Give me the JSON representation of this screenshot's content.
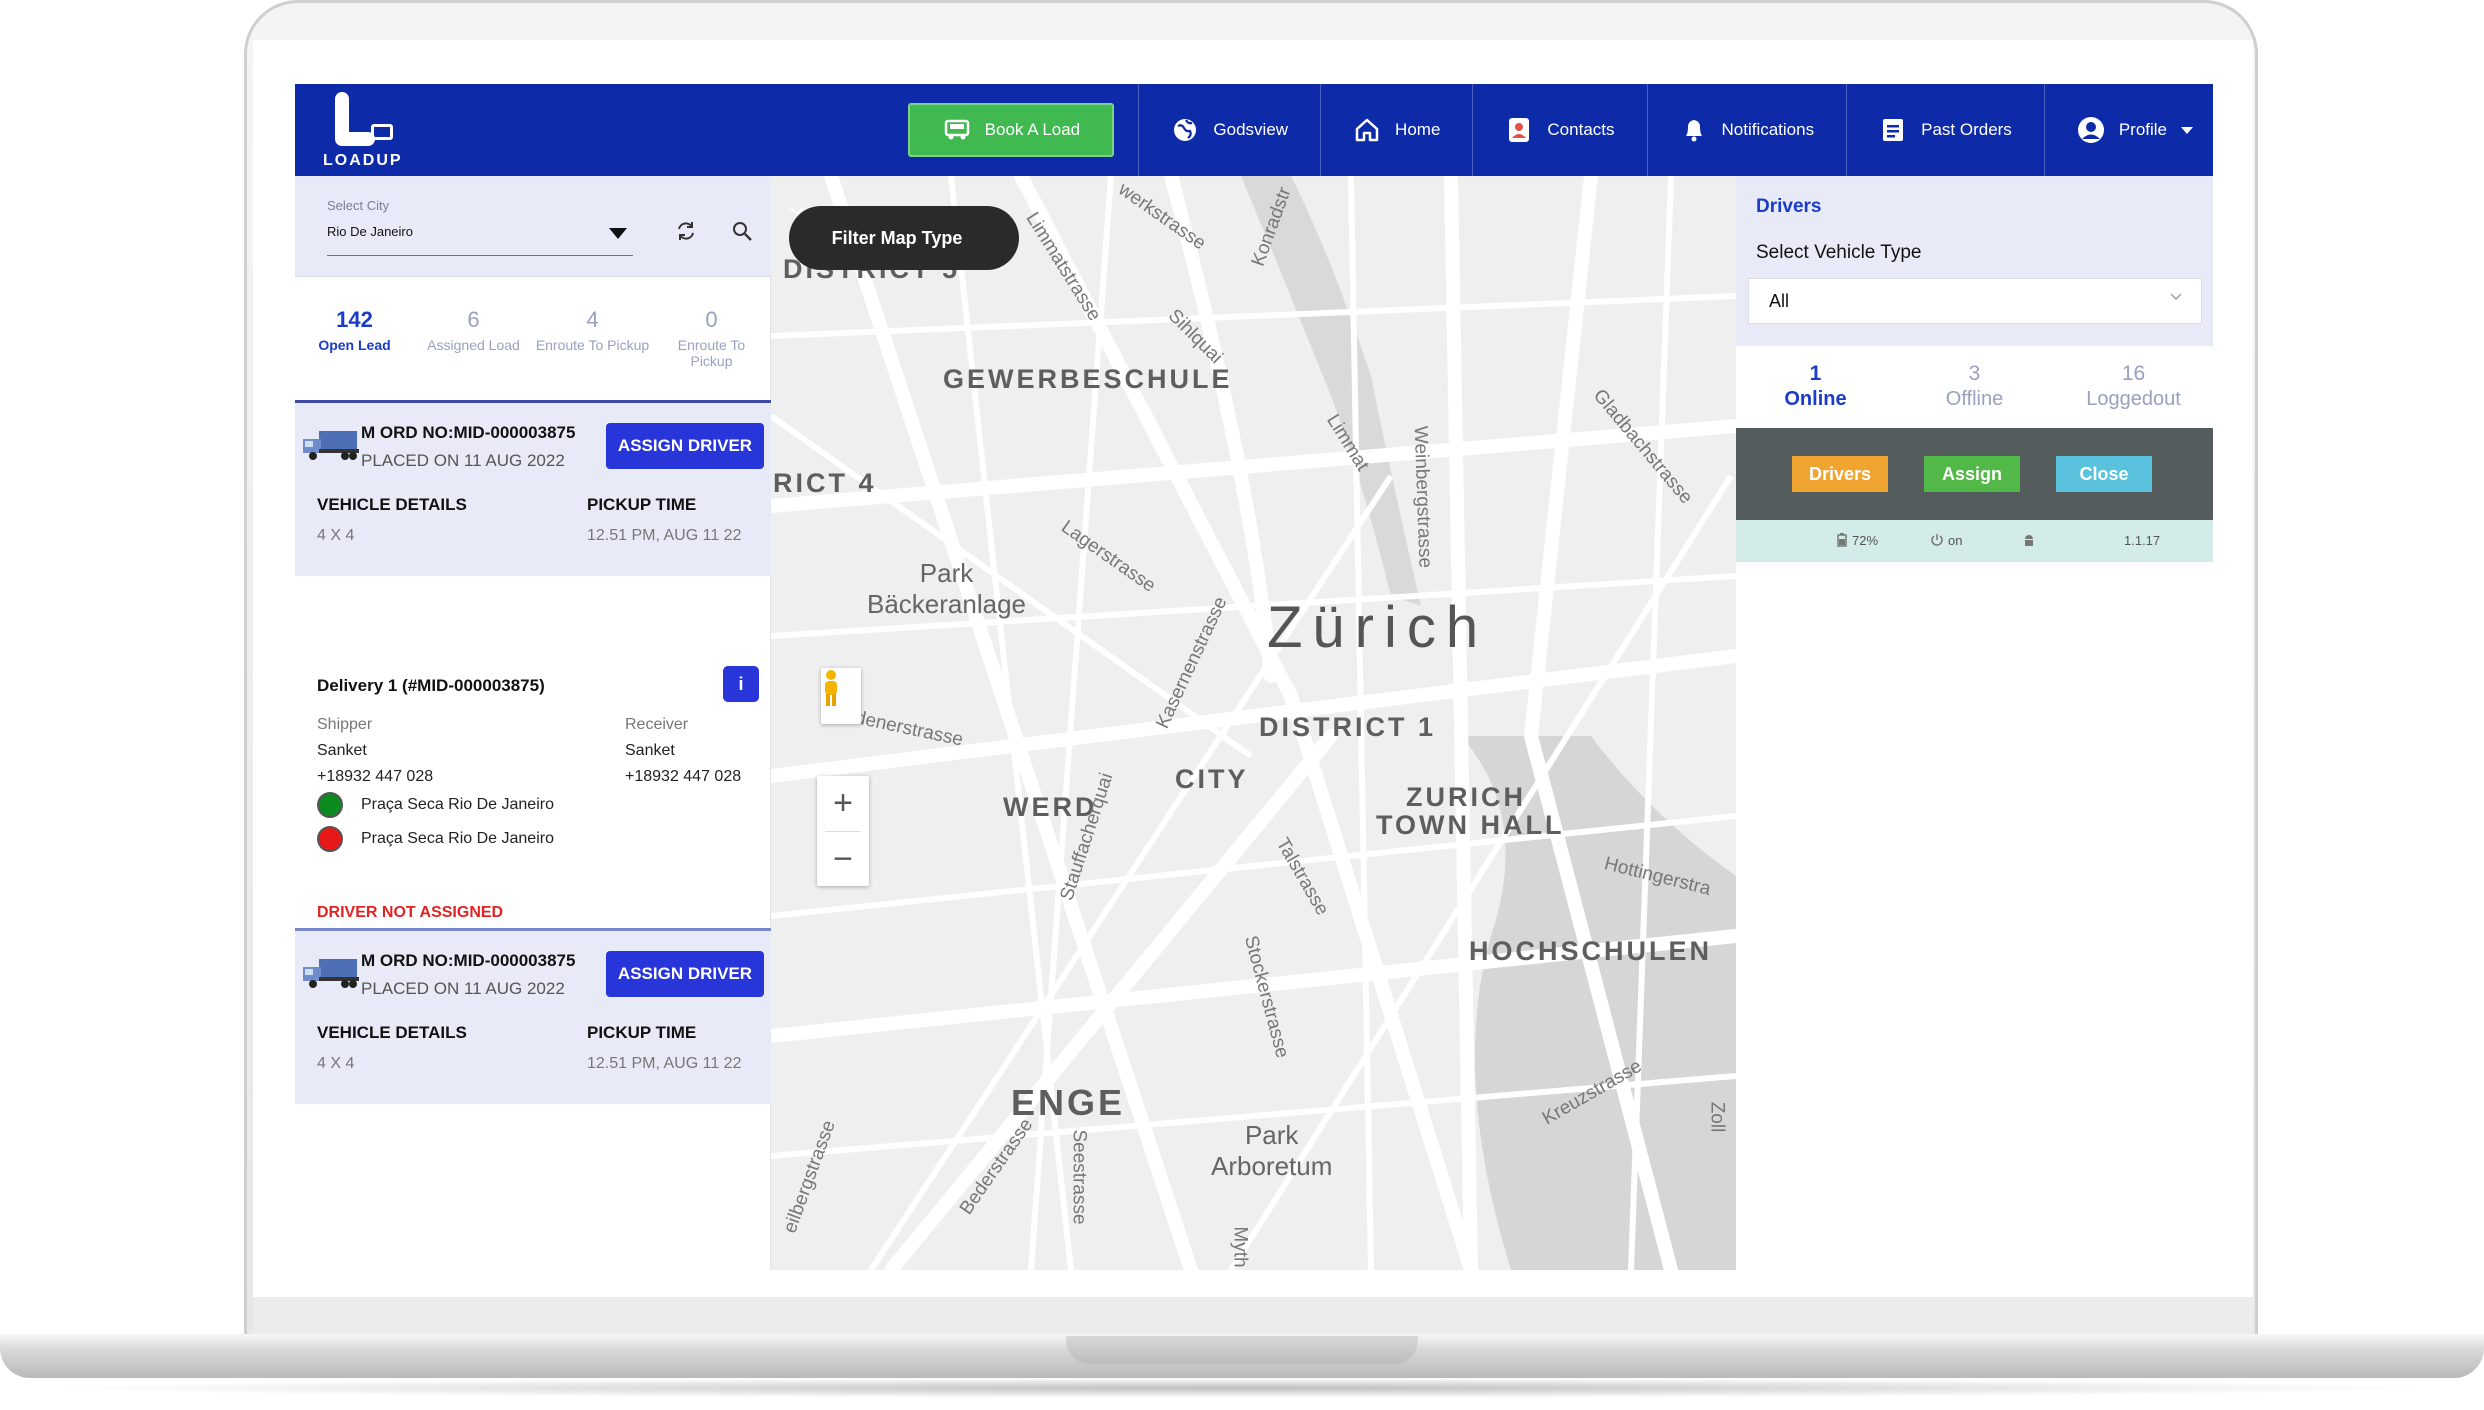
{
  "brand": {
    "logo_text": "LOADUP"
  },
  "nav": {
    "book_load": "Book A Load",
    "items": [
      {
        "label": "Godsview",
        "icon": "globe-icon"
      },
      {
        "label": "Home",
        "icon": "home-icon"
      },
      {
        "label": "Contacts",
        "icon": "contacts-icon"
      },
      {
        "label": "Notifications",
        "icon": "bell-icon"
      },
      {
        "label": "Past Orders",
        "icon": "document-icon"
      },
      {
        "label": "Profile",
        "icon": "user-circle-icon"
      }
    ]
  },
  "city": {
    "label": "Select City",
    "value": "Rio De Janeiro"
  },
  "lead_stats": [
    {
      "count": "142",
      "label": "Open Lead"
    },
    {
      "count": "6",
      "label": "Assigned Load"
    },
    {
      "count": "4",
      "label": "Enroute To Pickup"
    },
    {
      "count": "0",
      "label": "Enroute To Pickup"
    }
  ],
  "orders": [
    {
      "order_no": "M ORD NO:MID-000003875",
      "placed": "PLACED ON 11 AUG 2022",
      "assign_label": "ASSIGN DRIVER",
      "vehicle_header": "VEHICLE DETAILS",
      "vehicle_value": "4 X 4",
      "pickup_header": "PICKUP TIME",
      "pickup_value": "12.51 PM, AUG 11 22"
    },
    {
      "order_no": "M ORD NO:MID-000003875",
      "placed": "PLACED ON 11 AUG 2022",
      "assign_label": "ASSIGN DRIVER",
      "vehicle_header": "VEHICLE DETAILS",
      "vehicle_value": "4 X 4",
      "pickup_header": "PICKUP TIME",
      "pickup_value": "12.51 PM, AUG 11 22"
    }
  ],
  "delivery": {
    "title": "Delivery 1 (#MID-000003875)",
    "info_icon": "i",
    "shipper_label": "Shipper",
    "shipper_name": "Sanket",
    "shipper_phone": "+18932 447 028",
    "receiver_label": "Receiver",
    "receiver_name": "Sanket",
    "receiver_phone": "+18932 447 028",
    "pickup_address": "Praça Seca Rio De Janeiro",
    "drop_address": "Praça Seca Rio De Janeiro",
    "pickup_color": "#0a8a1f",
    "drop_color": "#e81818",
    "status": "DRIVER NOT ASSIGNED"
  },
  "map": {
    "filter_label": "Filter Map Type",
    "zoom_in": "+",
    "zoom_out": "−",
    "city_label": "Zürich",
    "district_labels": [
      "DISTRICT 5",
      "GEWERBESCHULE",
      "RICT 4",
      "DISTRICT 1",
      "CITY",
      "WERD",
      "ZURICH",
      "TOWN HALL",
      "HOCHSCHULEN",
      "ENGE"
    ],
    "park_labels": [
      "Park",
      "Bäckeranlage",
      "Park",
      "Arboretum"
    ],
    "street_labels": [
      "Limmatstrasse",
      "werkstrasse",
      "Konradstr",
      "Sihlquai",
      "Limmat",
      "Weinbergstrasse",
      "Gladbachstrasse",
      "Lagerstrasse",
      "Kasernenstrasse",
      "Badenerstrasse",
      "Stauffacherquai",
      "Talstrasse",
      "Hottingerstra",
      "Stockerstrasse",
      "Kreuzstrasse",
      "Bederstrasse",
      "Seestrasse",
      "eilbergstrasse",
      "Myth",
      "Zoll"
    ]
  },
  "drivers": {
    "title": "Drivers",
    "vehicle_type_label": "Select Vehicle Type",
    "vehicle_type_value": "All",
    "stats": [
      {
        "count": "1",
        "label": "Online"
      },
      {
        "count": "3",
        "label": "Offline"
      },
      {
        "count": "16",
        "label": "Loggedout"
      }
    ],
    "actions": [
      {
        "label": "Drivers",
        "color": "#f0a531"
      },
      {
        "label": "Assign",
        "color": "#52b848"
      },
      {
        "label": "Close",
        "color": "#5bc2de"
      }
    ],
    "status": {
      "battery": "72%",
      "power": "on",
      "version": "1.1.17"
    }
  },
  "colors": {
    "primary": "#0d2aa8",
    "accent_blue": "#2735d9",
    "panel_bg": "#e8ebf7",
    "book_green": "#3fb950"
  }
}
